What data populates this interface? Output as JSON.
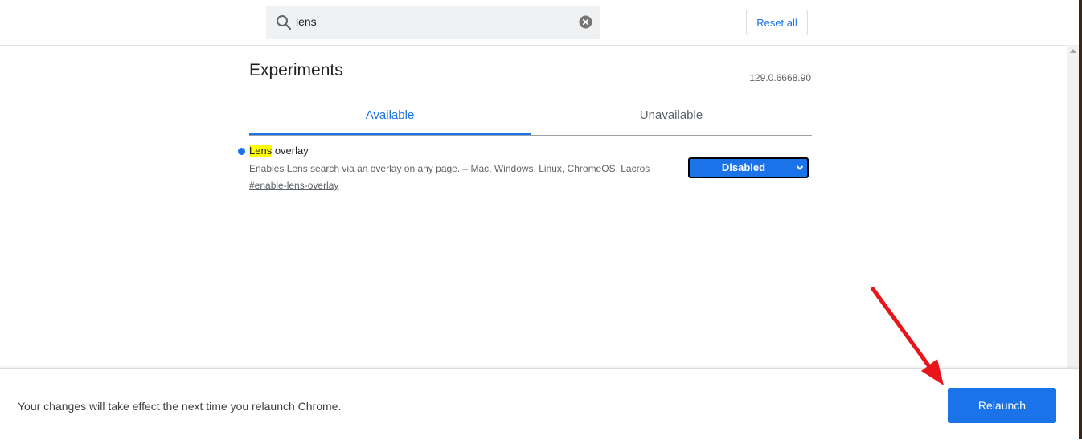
{
  "header": {
    "search": {
      "value": "lens",
      "placeholder": "Search flags"
    },
    "reset_all_label": "Reset all"
  },
  "main": {
    "title": "Experiments",
    "version": "129.0.6668.90",
    "tabs": [
      {
        "label": "Available",
        "active": true
      },
      {
        "label": "Unavailable",
        "active": false
      }
    ],
    "experiment": {
      "title_highlight": "Lens",
      "title_rest": " overlay",
      "description": "Enables Lens search via an overlay on any page. – Mac, Windows, Linux, ChromeOS, Lacros",
      "link": "#enable-lens-overlay",
      "state": "Disabled"
    }
  },
  "footer": {
    "message": "Your changes will take effect the next time you relaunch Chrome.",
    "relaunch_label": "Relaunch"
  },
  "colors": {
    "accent": "#1a73e8",
    "highlight": "#ffff00",
    "annotation_arrow": "#e8161b"
  },
  "icons": {
    "search": "search-icon",
    "clear": "clear-icon",
    "dropdown": "chevron-down-icon",
    "annotation": "red-arrow"
  }
}
